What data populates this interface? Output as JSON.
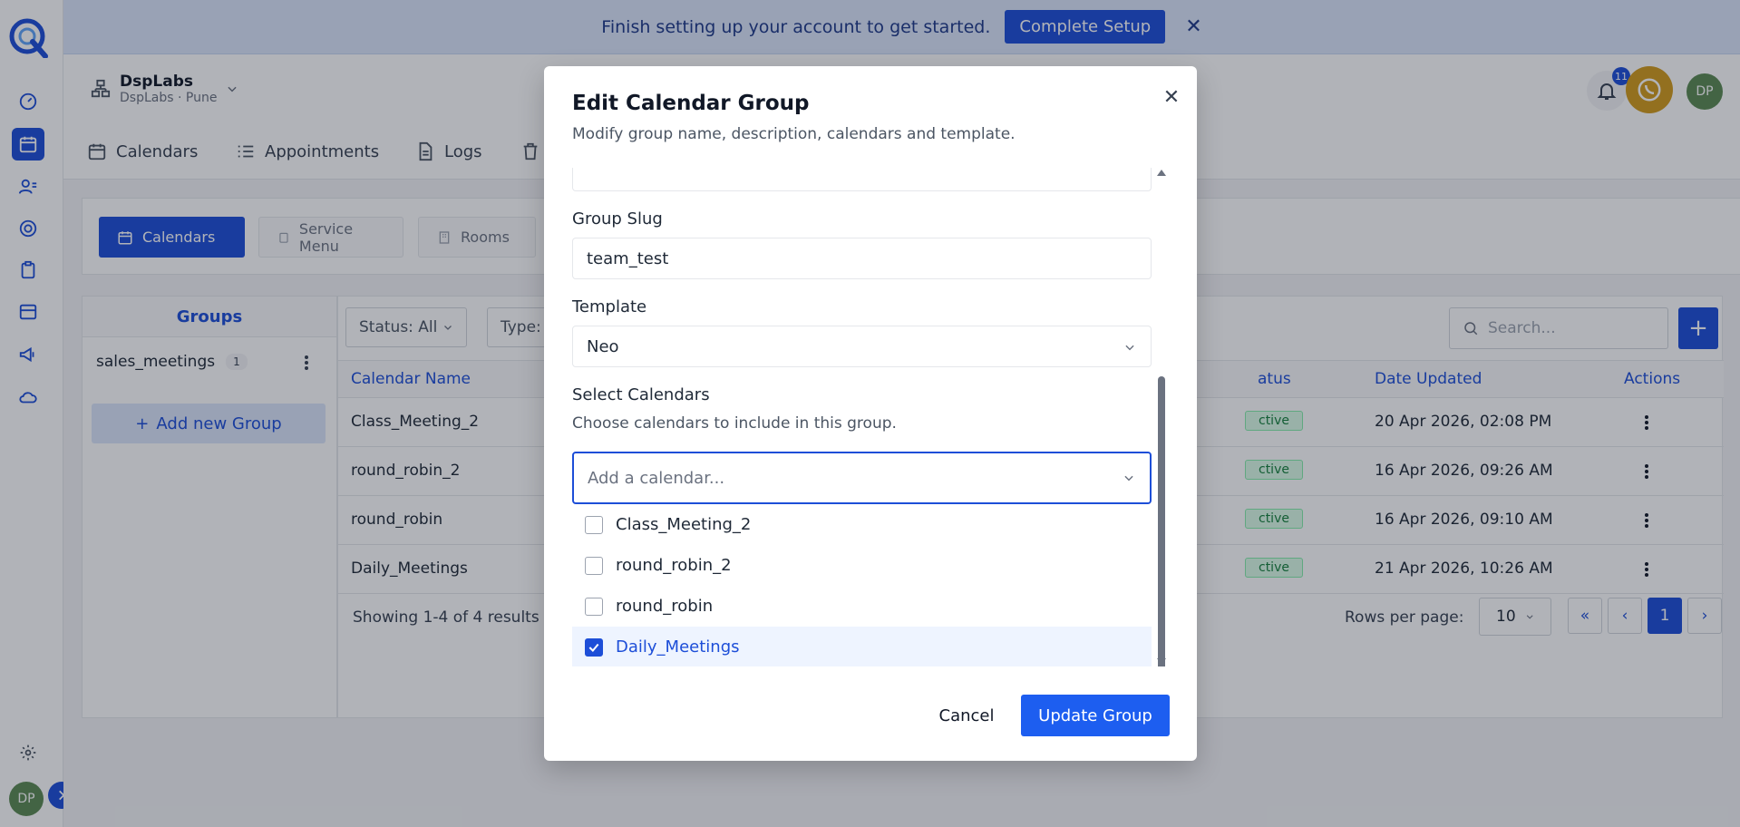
{
  "banner": {
    "text": "Finish setting up your account to get started.",
    "button": "Complete Setup"
  },
  "org": {
    "name": "DspLabs",
    "sub": "DspLabs · Pune"
  },
  "notifications": {
    "count": "11"
  },
  "user": {
    "initials": "DP"
  },
  "nav": {
    "calendars": "Calendars",
    "appointments": "Appointments",
    "logs": "Logs"
  },
  "subtabs": {
    "calendars": "Calendars",
    "service_menu": "Service Menu",
    "rooms": "Rooms"
  },
  "groups": {
    "title": "Groups",
    "items": [
      {
        "name": "sales_meetings",
        "count": "1"
      }
    ],
    "add_label": "Add new Group"
  },
  "filters": {
    "status": "Status: All",
    "type": "Type:"
  },
  "search": {
    "placeholder": "Search..."
  },
  "table": {
    "headers": {
      "name": "Calendar Name",
      "status": "atus",
      "date": "Date Updated",
      "actions": "Actions"
    },
    "rows": [
      {
        "name": "Class_Meeting_2",
        "status": "ctive",
        "date": "20 Apr 2026, 02:08 PM"
      },
      {
        "name": "round_robin_2",
        "status": "ctive",
        "date": "16 Apr 2026, 09:26 AM"
      },
      {
        "name": "round_robin",
        "status": "ctive",
        "date": "16 Apr 2026, 09:10 AM"
      },
      {
        "name": "Daily_Meetings",
        "status": "ctive",
        "date": "21 Apr 2026, 10:26 AM"
      }
    ],
    "showing": "Showing 1-4 of 4 results",
    "rows_per_page_label": "Rows per page:",
    "rows_per_page": "10",
    "page": "1"
  },
  "modal": {
    "title": "Edit Calendar Group",
    "subtitle": "Modify group name, description, calendars and template.",
    "slug_label": "Group Slug",
    "slug_value": "team_test",
    "template_label": "Template",
    "template_value": "Neo",
    "select_label": "Select Calendars",
    "select_help": "Choose calendars to include in this group.",
    "combo_placeholder": "Add a calendar...",
    "options": [
      {
        "label": "Class_Meeting_2",
        "checked": false
      },
      {
        "label": "round_robin_2",
        "checked": false
      },
      {
        "label": "round_robin",
        "checked": false
      },
      {
        "label": "Daily_Meetings",
        "checked": true
      }
    ],
    "cancel": "Cancel",
    "submit": "Update Group"
  },
  "colors": {
    "primary": "#1d4ed8",
    "banner_bg": "#dbe6fb",
    "active_green": "#15803d"
  }
}
